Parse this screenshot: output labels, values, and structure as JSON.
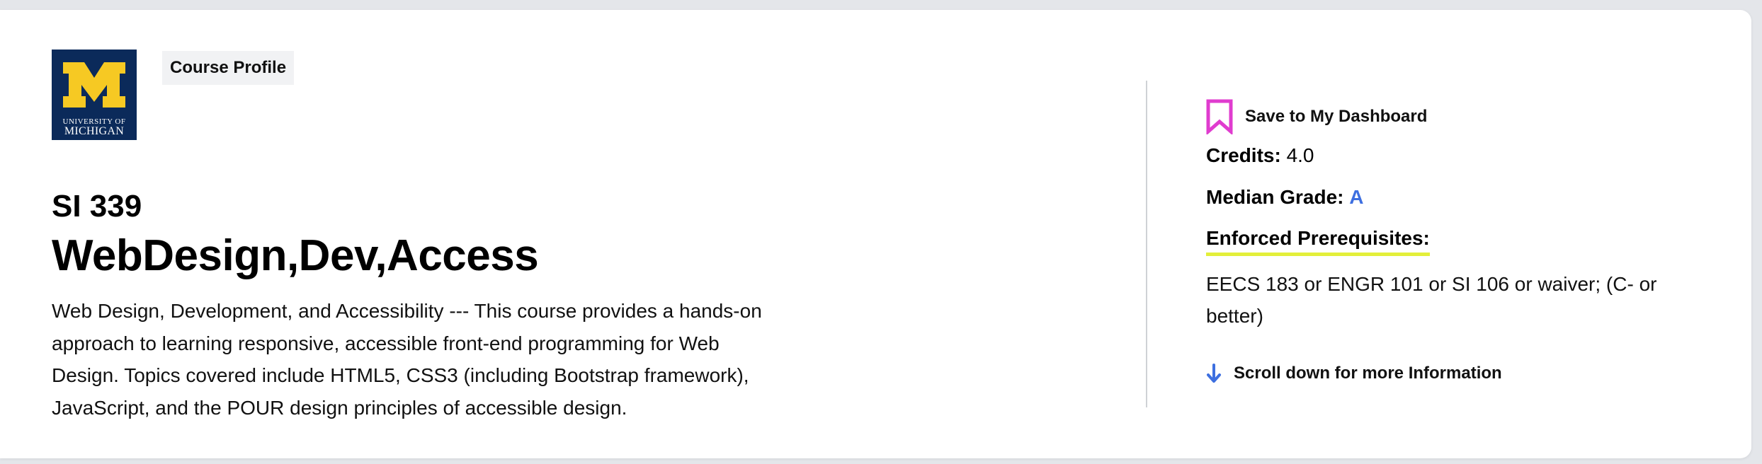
{
  "logo": {
    "letter": "M",
    "line1": "UNIVERSITY OF",
    "line2": "MICHIGAN",
    "colors": {
      "background": "#0b2a5a",
      "block_m": "#f6c923"
    }
  },
  "header": {
    "badge": "Course Profile"
  },
  "course": {
    "code": "SI 339",
    "title": "WebDesign,Dev,Access",
    "description": "Web Design, Development, and Accessibility --- This course provides a hands-on approach to learning responsive, accessible front-end programming for Web Design. Topics covered include HTML5, CSS3 (including Bootstrap framework), JavaScript, and the POUR design principles of accessible design."
  },
  "sidebar": {
    "save": {
      "label": "Save to My Dashboard",
      "icon": "bookmark-icon",
      "icon_color": "#e03ccf"
    },
    "credits": {
      "label": "Credits:",
      "value": "4.0"
    },
    "median_grade": {
      "label": "Median Grade:",
      "value": "A",
      "color": "#3d6fe0"
    },
    "prerequisites": {
      "label": "Enforced Prerequisites:",
      "text": "EECS 183 or ENGR 101 or SI 106 or waiver; (C- or better)",
      "underline_color": "#e3ef3a"
    },
    "scroll_hint": {
      "label": "Scroll down for more Information",
      "icon": "arrow-down-icon",
      "icon_color": "#3d6fe0"
    }
  }
}
